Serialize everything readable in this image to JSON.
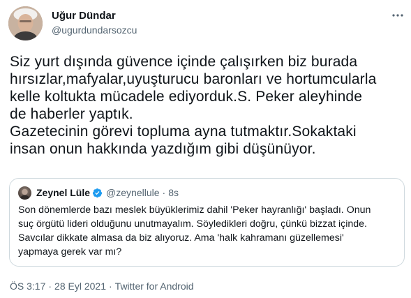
{
  "author": {
    "name": "Uğur Dündar",
    "handle": "@ugurdundarsozcu"
  },
  "tweet": {
    "text": "Siz yurt dışında güvence içinde çalışırken biz burada\nhırsızlar,mafyalar,uyuşturucu baronları ve hortumcularla\nkelle koltukta mücadele ediyorduk.S. Peker aleyhinde\nde haberler yaptık.\nGazetecinin görevi topluma ayna tutmaktır.Sokaktaki\ninsan onun hakkında yazdığım gibi düşünüyor."
  },
  "quoted": {
    "name": "Zeynel Lüle",
    "handle": "@zeynellule",
    "dot": "·",
    "time": "8s",
    "text": "Son dönemlerde bazı meslek büyüklerimiz dahil 'Peker hayranlığı' başladı. Onun\nsuç örgütü lideri olduğunu unutmayalım. Söyledikleri doğru, çünkü bizzat içinde.\nSavcılar dikkate almasa da biz alıyoruz. Ama 'halk kahramanı güzellemesi'\nyapmaya gerek var mı?",
    "verified_color": "#1d9bf0"
  },
  "meta": {
    "time": "ÖS 3:17",
    "sep1": "·",
    "date": "28 Eyl 2021",
    "sep2": "·",
    "source": "Twitter for Android"
  },
  "icons": {
    "more": "more-dots-icon",
    "verified": "verified-badge-icon"
  },
  "colors": {
    "text": "#0f1419",
    "secondary": "#536471",
    "border": "#cfd9de",
    "accent": "#1d9bf0"
  }
}
